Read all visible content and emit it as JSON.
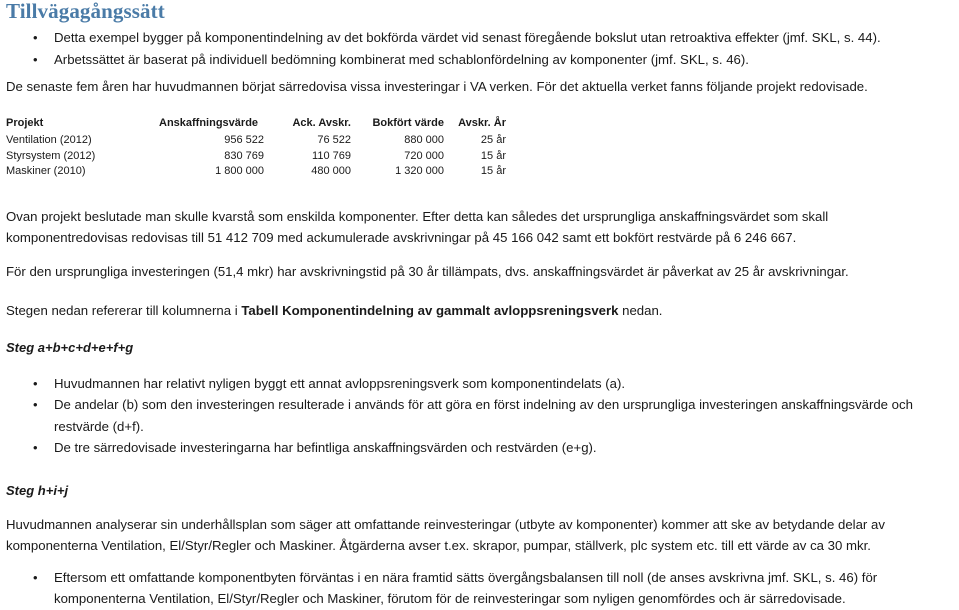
{
  "document": {
    "title": "Tillvägagångssätt",
    "title_color": "#4a7ba7"
  },
  "intro_bullets": [
    "Detta exempel bygger på komponentindelning av det bokförda värdet vid senast föregående bokslut utan retroaktiva effekter (jmf. SKL, s. 44).",
    "Arbetssättet är baserat på individuell bedömning kombinerat med schablonfördelning av komponenter (jmf. SKL, s. 46)."
  ],
  "intro_paragraph": "De senaste fem åren har huvudmannen börjat särredovisa vissa investeringar i VA verken. För det aktuella verket fanns följande projekt redovisade.",
  "table": {
    "headers": [
      "Projekt",
      "Anskaffningsvärde",
      "Ack. Avskr.",
      "Bokfört värde",
      "Avskr. År"
    ],
    "rows": [
      [
        "Ventilation (2012)",
        "956 522",
        "76 522",
        "880 000",
        "25 år"
      ],
      [
        "Styrsystem (2012)",
        "830 769",
        "110 769",
        "720 000",
        "15 år"
      ],
      [
        "Maskiner (2010)",
        "1 800 000",
        "480 000",
        "1 320 000",
        "15 år"
      ]
    ]
  },
  "paragraphs": {
    "ovan_projekt": "Ovan projekt beslutade man skulle kvarstå som enskilda komponenter. Efter detta kan således det ursprungliga anskaffningsvärdet som skall komponentredovisas redovisas till 51 412 709 med ackumulerade avskrivningar på 45 166 042 samt ett bokfört restvärde på 6 246 667.",
    "ursprungliga": "För den ursprungliga investeringen (51,4 mkr) har avskrivningstid på 30 år tillämpats, dvs. anskaffningsvärdet är påverkat av 25 år avskrivningar.",
    "stegen_prefix": "Stegen nedan refererar till kolumnerna i ",
    "stegen_bold": "Tabell Komponentindelning av gammalt avloppsreningsverk",
    "stegen_suffix": " nedan.",
    "underhallsplan": "Huvudmannen analyserar sin underhållsplan som säger att omfattande reinvesteringar (utbyte av komponenter) kommer att ske av betydande delar av komponenterna Ventilation, El/Styr/Regler och Maskiner. Åtgärderna avser t.ex. skrapor, pumpar, ställverk, plc system etc. till ett värde av ca 30 mkr."
  },
  "steg_abcdefg": {
    "heading": "Steg a+b+c+d+e+f+g",
    "bullets": [
      "Huvudmannen har relativt nyligen byggt ett annat avloppsreningsverk som komponentindelats (a).",
      "De andelar (b) som den investeringen resulterade i används för att göra en först indelning av den ursprungliga investeringen anskaffningsvärde och restvärde (d+f).",
      "De tre särredovisade investeringarna har befintliga anskaffningsvärden och restvärden (e+g)."
    ]
  },
  "steg_hij": {
    "heading": "Steg h+i+j",
    "bullets": [
      "Eftersom ett omfattande komponentbyten förväntas i en nära framtid sätts övergångsbalansen till noll (de anses avskrivna jmf. SKL, s. 46) för komponenterna Ventilation, El/Styr/Regler och Maskiner, förutom för de reinvesteringar som nyligen genomfördes och är särredovisade."
    ]
  }
}
